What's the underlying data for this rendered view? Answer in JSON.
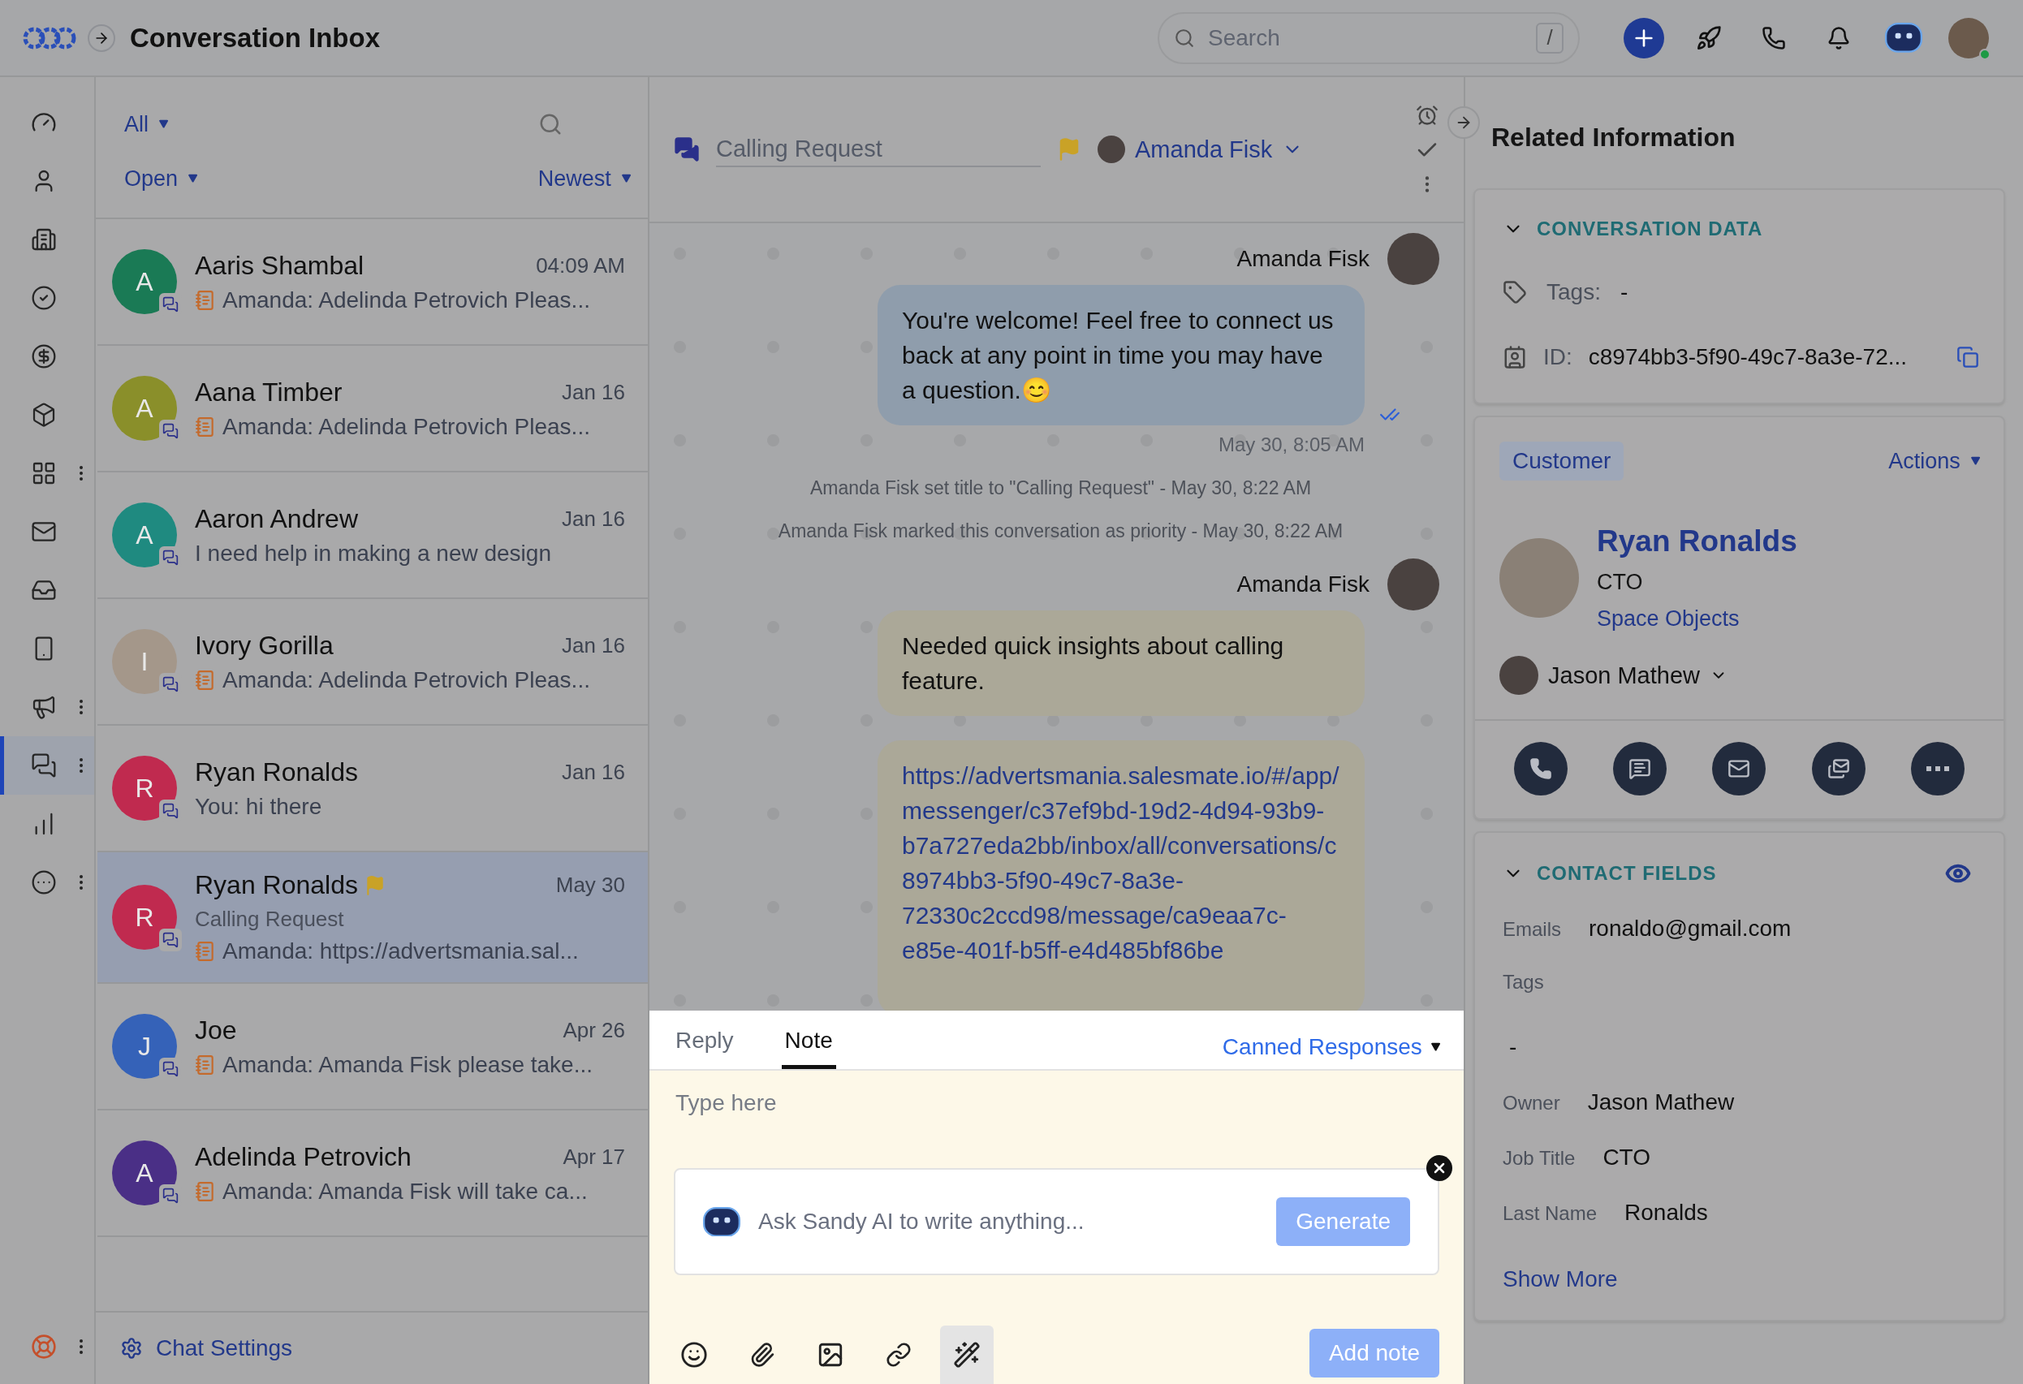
{
  "header": {
    "title": "Conversation Inbox",
    "search_placeholder": "Search",
    "search_shortcut": "/"
  },
  "nav": [
    {
      "kind": "dashboard",
      "selected": false,
      "more": false
    },
    {
      "kind": "contacts",
      "selected": false,
      "more": false
    },
    {
      "kind": "companies",
      "selected": false,
      "more": false
    },
    {
      "kind": "tasks",
      "selected": false,
      "more": false
    },
    {
      "kind": "deals",
      "selected": false,
      "more": false
    },
    {
      "kind": "products",
      "selected": false,
      "more": false
    },
    {
      "kind": "apps",
      "selected": false,
      "more": true
    },
    {
      "kind": "email",
      "selected": false,
      "more": false
    },
    {
      "kind": "inbox",
      "selected": false,
      "more": false
    },
    {
      "kind": "sms",
      "selected": false,
      "more": false
    },
    {
      "kind": "campaigns",
      "selected": false,
      "more": true
    },
    {
      "kind": "conversations",
      "selected": true,
      "more": true
    },
    {
      "kind": "reports",
      "selected": false,
      "more": false
    },
    {
      "kind": "more",
      "selected": false,
      "more": true
    }
  ],
  "list": {
    "filter": "All",
    "status": "Open",
    "sort": "Newest",
    "footer": "Chat Settings",
    "conversations": [
      {
        "avatar": "A",
        "color": "#1a7a55",
        "name": "Aaris Shambal",
        "time": "04:09 AM",
        "preview": "Amanda: Adelinda Petrovich Pleas...",
        "note_icon": true,
        "selected": false,
        "flagged": false
      },
      {
        "avatar": "A",
        "color": "#8a8f2a",
        "name": "Aana Timber",
        "time": "Jan 16",
        "preview": "Amanda: Adelinda Petrovich Pleas...",
        "note_icon": true,
        "selected": false,
        "flagged": false
      },
      {
        "avatar": "A",
        "color": "#1f8a80",
        "name": "Aaron Andrew",
        "time": "Jan 16",
        "preview": "I need help in making a new design",
        "note_icon": false,
        "selected": false,
        "flagged": false
      },
      {
        "avatar": "I",
        "color": "#a4978a",
        "name": "Ivory Gorilla",
        "time": "Jan 16",
        "preview": "Amanda: Adelinda Petrovich Pleas...",
        "note_icon": true,
        "selected": false,
        "flagged": false
      },
      {
        "avatar": "R",
        "color": "#c02a4f",
        "name": "Ryan Ronalds",
        "time": "Jan 16",
        "preview": "You: hi there",
        "note_icon": false,
        "selected": false,
        "flagged": false
      },
      {
        "avatar": "R",
        "color": "#c02a4f",
        "name": "Ryan Ronalds",
        "time": "May 30",
        "subtitle": "Calling Request",
        "preview": "Amanda: https://advertsmania.sal...",
        "note_icon": true,
        "selected": true,
        "flagged": true
      },
      {
        "avatar": "J",
        "color": "#3562b8",
        "name": "Joe",
        "time": "Apr 26",
        "preview": "Amanda: Amanda Fisk please take...",
        "note_icon": true,
        "selected": false,
        "flagged": false
      },
      {
        "avatar": "A",
        "color": "#4a2f86",
        "name": "Adelinda Petrovich",
        "time": "Apr 17",
        "preview": "Amanda: Amanda Fisk will take ca...",
        "note_icon": true,
        "selected": false,
        "flagged": false
      }
    ]
  },
  "chat": {
    "title": "Calling Request",
    "flagged": true,
    "assignee": "Amanda Fisk",
    "messages": [
      {
        "kind": "reply",
        "sender": "Amanda Fisk",
        "text": "You're welcome! Feel free to connect us back at any point in time you may have a question.😊",
        "time": "May 30, 8:05 AM",
        "read": true
      },
      {
        "kind": "event",
        "text": "Amanda Fisk set title to \"Calling Request\" - May 30, 8:22 AM"
      },
      {
        "kind": "event",
        "text": "Amanda Fisk marked this conversation as priority - May 30, 8:22 AM"
      },
      {
        "kind": "note",
        "sender": "Amanda Fisk",
        "text": "Needed quick insights about calling feature."
      },
      {
        "kind": "link",
        "text": "https://advertsmania.salesmate.io/#/app/messenger/c37ef9bd-19d2-4d94-93b9-b7a727eda2bb/inbox/all/conversations/c8974bb3-5f90-49c7-8a3e-72330c2ccd98/message/ca9eaa7c-e85e-401f-b5ff-e4d485bf86be"
      }
    ]
  },
  "compose": {
    "tabs": [
      {
        "label": "Reply",
        "selected": false
      },
      {
        "label": "Note",
        "selected": true
      }
    ],
    "canned": "Canned Responses",
    "placeholder": "Type here",
    "ai_placeholder": "Ask Sandy AI to write anything...",
    "generate": "Generate",
    "submit": "Add note"
  },
  "related": {
    "title": "Related Information",
    "conversation_data": {
      "heading": "CONVERSATION DATA",
      "expanded": true,
      "tags_label": "Tags:",
      "tags_value": "-",
      "id_label": "ID:",
      "id_value": "c8974bb3-5f90-49c7-8a3e-72..."
    },
    "customer": {
      "badge": "Customer",
      "actions": "Actions",
      "name": "Ryan Ronalds",
      "job": "CTO",
      "company": "Space Objects",
      "owner": "Jason Mathew"
    },
    "contact_fields": {
      "heading": "CONTACT FIELDS",
      "expanded": true,
      "fields": [
        {
          "label": "Emails",
          "value": "ronaldo@gmail.com",
          "stacked": false
        },
        {
          "label": "Tags",
          "value": "-",
          "stacked": true
        },
        {
          "label": "Owner",
          "value": "Jason Mathew",
          "stacked": false
        },
        {
          "label": "Job Title",
          "value": "CTO",
          "stacked": false
        },
        {
          "label": "Last Name",
          "value": "Ronalds",
          "stacked": false
        }
      ],
      "show_more": "Show More"
    }
  }
}
